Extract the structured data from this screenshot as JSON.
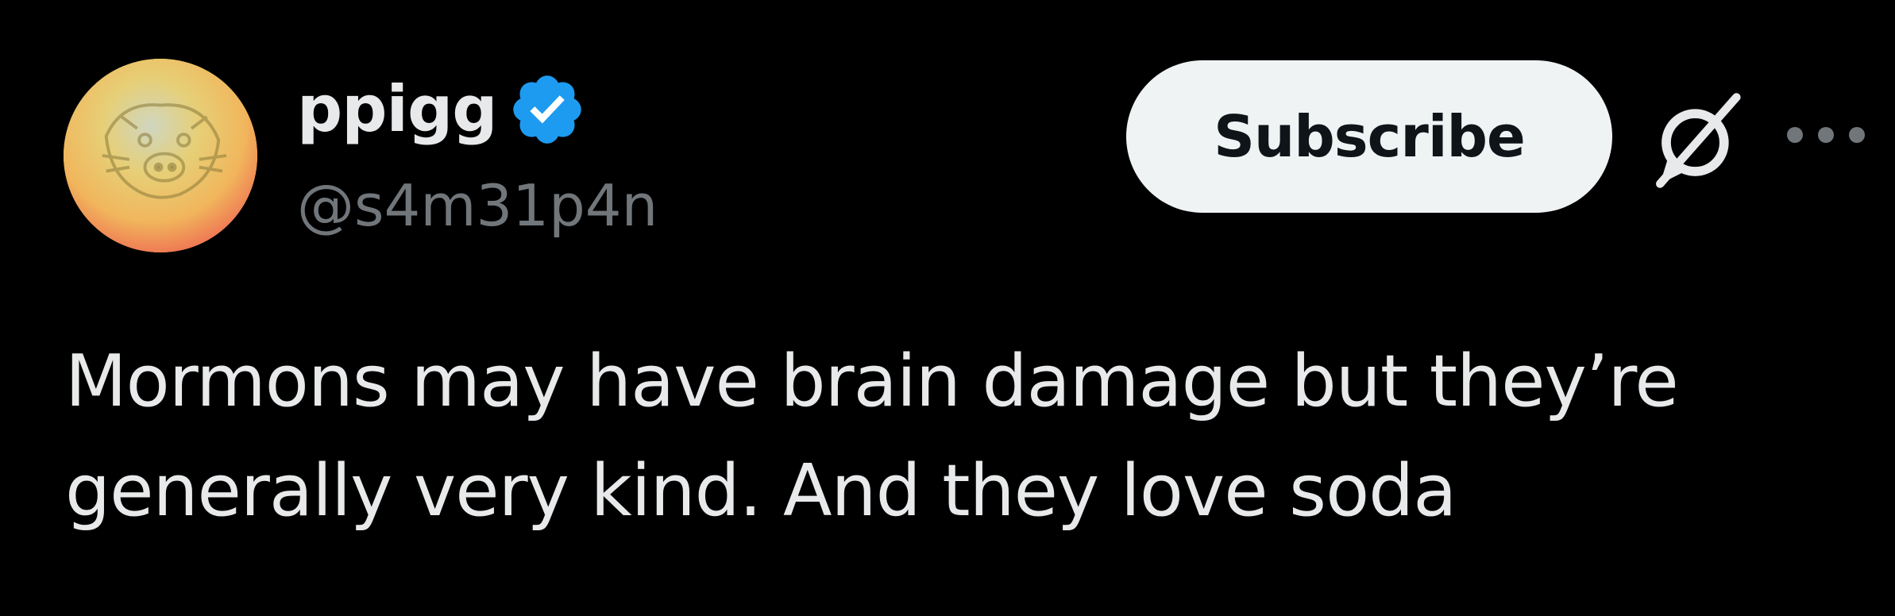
{
  "tweet": {
    "author": {
      "display_name": "ppigg",
      "handle": "@s4m31p4n",
      "verified": true,
      "avatar": "avatar-image"
    },
    "actions": {
      "subscribe_label": "Subscribe",
      "grok_icon": "grok-icon",
      "more_icon": "more-icon"
    },
    "text": "Mormons may have brain damage but they’re generally very kind. And they love soda"
  },
  "colors": {
    "background": "#000000",
    "primary_text": "#e7e9ea",
    "secondary_text": "#71767b",
    "verified_blue": "#1d9bf0",
    "button_bg": "#eff3f4",
    "button_text": "#0f1419"
  }
}
